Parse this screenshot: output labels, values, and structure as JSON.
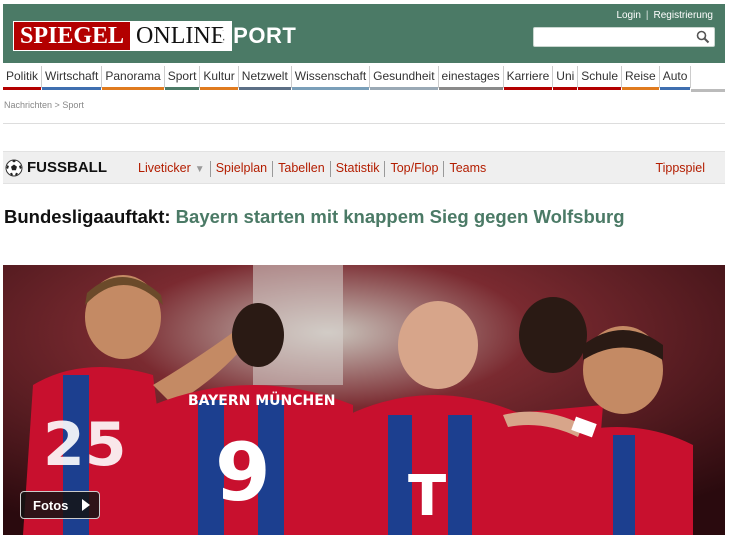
{
  "header": {
    "logo_left": "SPIEGEL",
    "logo_right": "ONLINE",
    "section": "SPORT",
    "login": "Login",
    "separator": "|",
    "register": "Registrierung",
    "search_placeholder": "",
    "colors": {
      "header_bg": "#4b7a66",
      "logo_red": "#b30000"
    }
  },
  "nav": {
    "items": [
      {
        "label": "Politik",
        "color": "#b30000"
      },
      {
        "label": "Wirtschaft",
        "color": "#3f6fb0"
      },
      {
        "label": "Panorama",
        "color": "#e07b1f"
      },
      {
        "label": "Sport",
        "color": "#4b7a66"
      },
      {
        "label": "Kultur",
        "color": "#e07b1f"
      },
      {
        "label": "Netzwelt",
        "color": "#5c6f86"
      },
      {
        "label": "Wissenschaft",
        "color": "#7a9fb9"
      },
      {
        "label": "Gesundheit",
        "color": "#9aa9b5"
      },
      {
        "label": "einestages",
        "color": "#8a8a8a"
      },
      {
        "label": "Karriere",
        "color": "#b30000"
      },
      {
        "label": "Uni",
        "color": "#b30000"
      },
      {
        "label": "Schule",
        "color": "#b30000"
      },
      {
        "label": "Reise",
        "color": "#e07b1f"
      },
      {
        "label": "Auto",
        "color": "#3f6fb0"
      }
    ]
  },
  "breadcrumb": {
    "home": "Nachrichten",
    "sep": ">",
    "current": "Sport"
  },
  "subnav": {
    "title": "FUSSBALL",
    "links": [
      "Liveticker",
      "Spielplan",
      "Tabellen",
      "Statistik",
      "Top/Flop",
      "Teams"
    ],
    "right_link": "Tippspiel"
  },
  "article": {
    "kicker": "Bundesligaauftakt:",
    "title": "Bayern starten mit knappem Sieg gegen Wolfsburg"
  },
  "photo": {
    "button_label": "Fotos"
  }
}
